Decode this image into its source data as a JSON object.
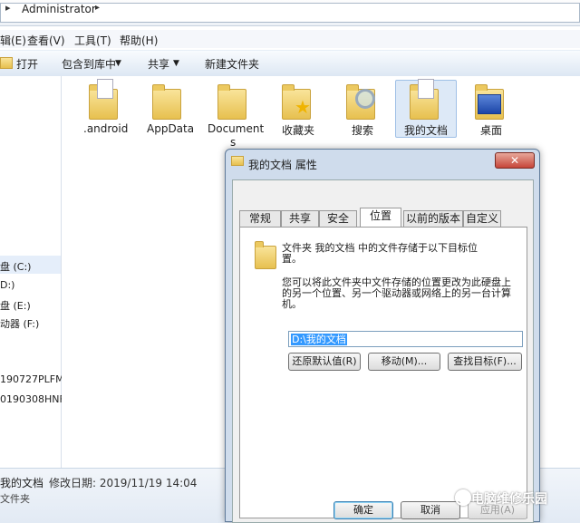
{
  "address": {
    "crumb": "Administrator"
  },
  "menu": [
    "查看(V)",
    "工具(T)",
    "帮助(H)"
  ],
  "menu_partial": "辑(E)",
  "toolbar": {
    "open": "打开",
    "include": "包含到库中",
    "share": "共享",
    "new_folder": "新建文件夹"
  },
  "nav": {
    "c_drive": "盘 (C:)",
    "d_drive": "D:)",
    "e_drive": "盘 (E:)",
    "f_drive": "动器 (F:)",
    "net1": "190727PLFM",
    "net2": "0190308HNF"
  },
  "folders": [
    ".android",
    "AppData",
    "Document",
    "收藏夹",
    "搜索",
    "我的文档",
    "桌面"
  ],
  "folder_wrap": "s",
  "status": {
    "name": "我的文档",
    "modified": "修改日期: 2019/11/19 14:04",
    "type": "文件夹"
  },
  "dialog": {
    "title": "我的文档 属性",
    "close": "✕",
    "tabs": [
      "常规",
      "共享",
      "安全",
      "位置",
      "以前的版本",
      "自定义"
    ],
    "line1": "文件夹 我的文档 中的文件存储于以下目标位",
    "line1b": "置。",
    "line2": "您可以将此文件夹中文件存储的位置更改为此硬盘上",
    "line2b": "的另一个位置、另一个驱动器或网络上的另一台计算",
    "line2c": "机。",
    "path": "D:\\我的文档",
    "btn_restore": "还原默认值(R)",
    "btn_move": "移动(M)...",
    "btn_find": "查找目标(F)...",
    "btn_ok": "确定",
    "btn_cancel": "取消",
    "btn_apply": "应用(A)"
  },
  "watermark": "电脑维修乐园"
}
